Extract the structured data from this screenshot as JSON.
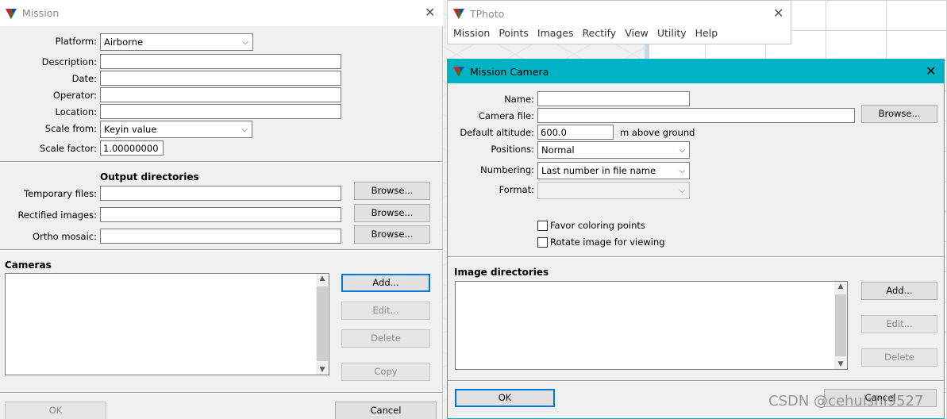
{
  "mission": {
    "title": "Mission",
    "platform": {
      "label": "Platform:",
      "value": "Airborne"
    },
    "description": {
      "label": "Description:",
      "value": ""
    },
    "date": {
      "label": "Date:",
      "value": ""
    },
    "operator": {
      "label": "Operator:",
      "value": ""
    },
    "location": {
      "label": "Location:",
      "value": ""
    },
    "scale_from": {
      "label": "Scale from:",
      "value": "Keyin value"
    },
    "scale_factor": {
      "label": "Scale factor:",
      "value": "1.00000000"
    },
    "output_dirs": {
      "title": "Output directories",
      "temporary": {
        "label": "Temporary files:",
        "value": "",
        "browse": "Browse..."
      },
      "rectified": {
        "label": "Rectified images:",
        "value": "",
        "browse": "Browse..."
      },
      "ortho": {
        "label": "Ortho mosaic:",
        "value": "",
        "browse": "Browse..."
      }
    },
    "cameras": {
      "title": "Cameras",
      "add": "Add...",
      "edit": "Edit...",
      "delete": "Delete",
      "copy": "Copy"
    },
    "ok": "OK",
    "cancel": "Cancel"
  },
  "tphoto": {
    "title": "TPhoto",
    "menu": [
      "Mission",
      "Points",
      "Images",
      "Rectify",
      "View",
      "Utility",
      "Help"
    ]
  },
  "mission_camera": {
    "title": "Mission Camera",
    "name": {
      "label": "Name:",
      "value": ""
    },
    "camera_file": {
      "label": "Camera file:",
      "value": "",
      "browse": "Browse..."
    },
    "default_altitude": {
      "label": "Default altitude:",
      "value": "600.0",
      "unit": "m above ground"
    },
    "positions": {
      "label": "Positions:",
      "value": "Normal"
    },
    "numbering": {
      "label": "Numbering:",
      "value": "Last number in file name"
    },
    "format": {
      "label": "Format:",
      "value": ""
    },
    "favor_coloring": {
      "label": "Favor coloring points",
      "checked": false
    },
    "rotate_image": {
      "label": "Rotate image for viewing",
      "checked": false
    },
    "image_dirs": {
      "title": "Image directories",
      "add": "Add...",
      "edit": "Edit...",
      "delete": "Delete"
    },
    "ok": "OK",
    "cancel": "Cancel",
    "title_bar_color": "#00b4c5"
  },
  "watermark": "CSDN @cehuishi9527"
}
